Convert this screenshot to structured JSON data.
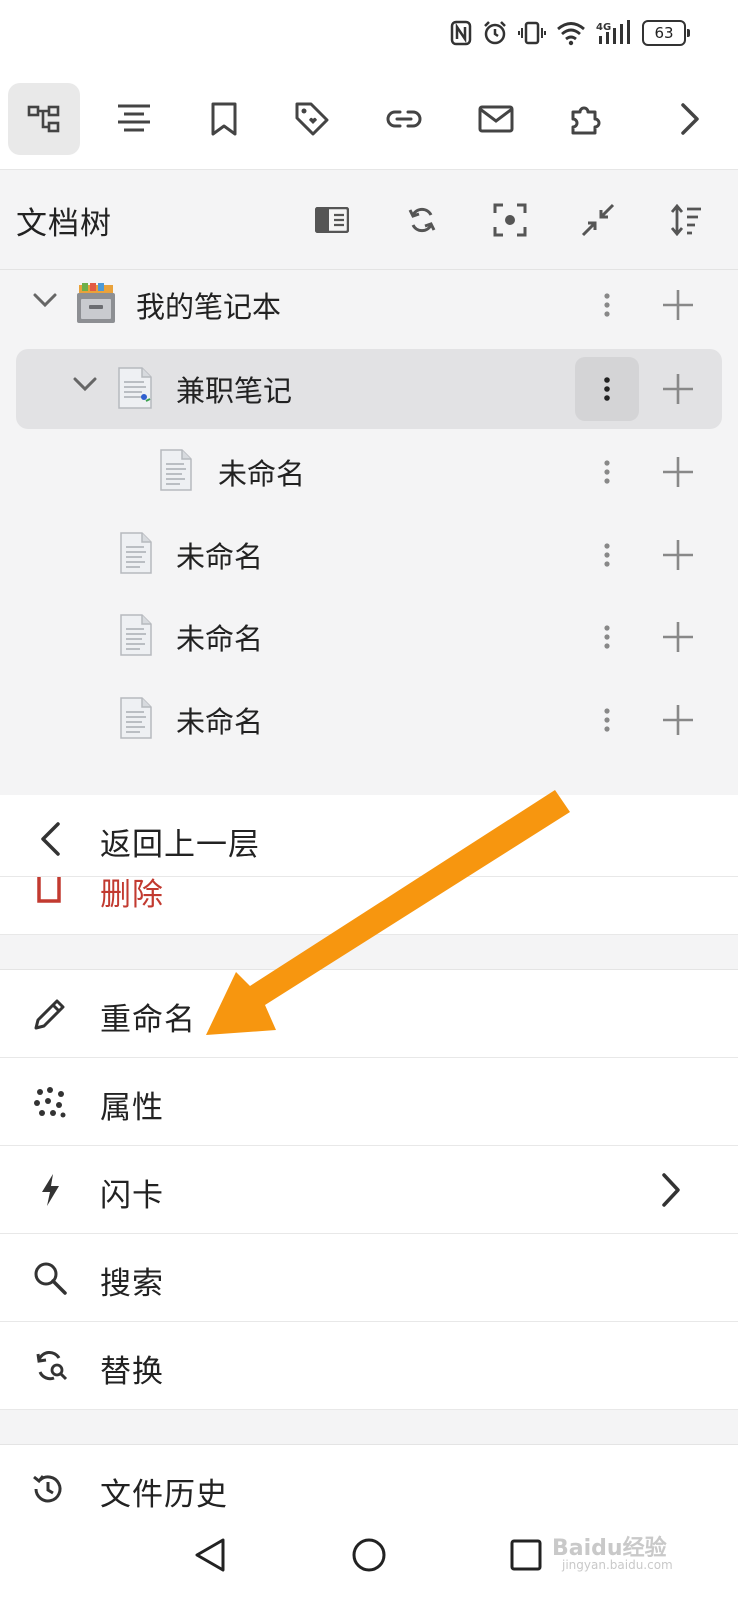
{
  "status_bar": {
    "battery": "63"
  },
  "toolbar": {
    "buttons": [
      "file-tree-icon",
      "outline-icon",
      "bookmark-icon",
      "tag-icon",
      "backlink-icon",
      "inbox-icon",
      "plugin-icon",
      "chevron-right-icon"
    ]
  },
  "dock": {
    "title": "文档树"
  },
  "tree": {
    "notebook": {
      "label": "我的笔记本"
    },
    "items": [
      {
        "label": "兼职笔记",
        "selected": true
      },
      {
        "label": "未命名"
      },
      {
        "label": "未命名"
      },
      {
        "label": "未命名"
      },
      {
        "label": "未命名"
      }
    ]
  },
  "menu": {
    "back": "返回上一层",
    "delete": "删除",
    "rename": "重命名",
    "attributes": "属性",
    "flashcard": "闪卡",
    "search": "搜索",
    "replace": "替换",
    "history": "文件历史"
  },
  "watermark": {
    "main": "Baidu经验",
    "sub": "jingyan.baidu.com"
  },
  "colors": {
    "accent_arrow": "#f7960f",
    "delete_red": "#c23a30",
    "panel_bg": "#f4f4f5"
  }
}
